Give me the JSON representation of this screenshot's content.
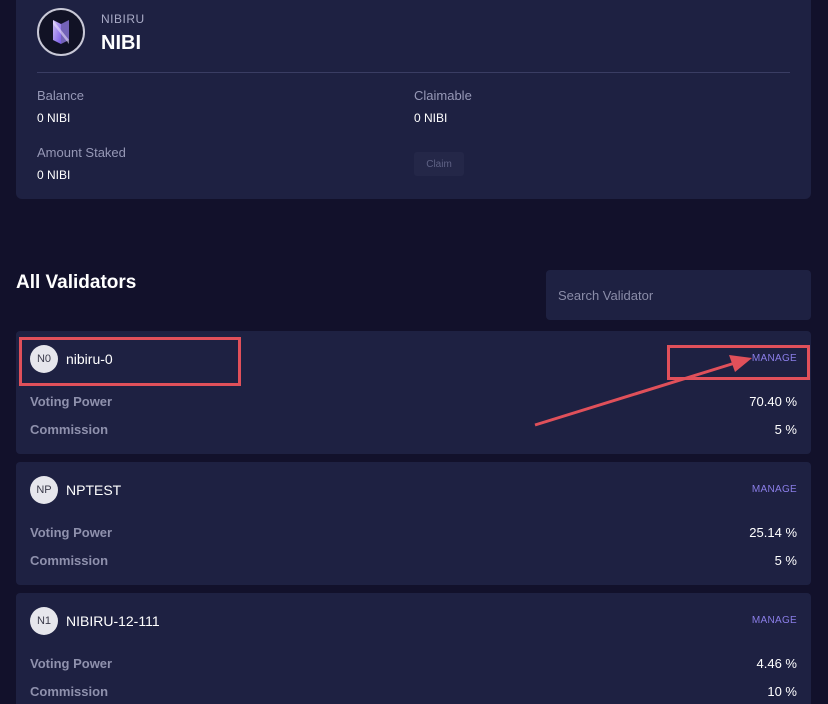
{
  "token": {
    "subtitle": "NIBIRU",
    "name": "NIBI",
    "balance_label": "Balance",
    "balance_value": "0 NIBI",
    "claimable_label": "Claimable",
    "claimable_value": "0 NIBI",
    "staked_label": "Amount Staked",
    "staked_value": "0 NIBI",
    "claim_label": "Claim",
    "logo_icon": "nibiru-logo-icon"
  },
  "validators_section": {
    "title": "All Validators",
    "search_placeholder": "Search Validator"
  },
  "validators": [
    {
      "initials": "N0",
      "name": "nibiru-0",
      "manage_label": "MANAGE",
      "voting_power_label": "Voting Power",
      "voting_power": "70.40 %",
      "commission_label": "Commission",
      "commission": "5 %"
    },
    {
      "initials": "NP",
      "name": "NPTEST",
      "manage_label": "MANAGE",
      "voting_power_label": "Voting Power",
      "voting_power": "25.14 %",
      "commission_label": "Commission",
      "commission": "5 %"
    },
    {
      "initials": "N1",
      "name": "NIBIRU-12-111",
      "manage_label": "MANAGE",
      "voting_power_label": "Voting Power",
      "voting_power": "4.46 %",
      "commission_label": "Commission",
      "commission": "10 %"
    }
  ],
  "annotation": {
    "color": "#e0505a"
  },
  "colors": {
    "background": "#12112b",
    "card": "#1e2142",
    "accent": "#8b7ee8"
  }
}
